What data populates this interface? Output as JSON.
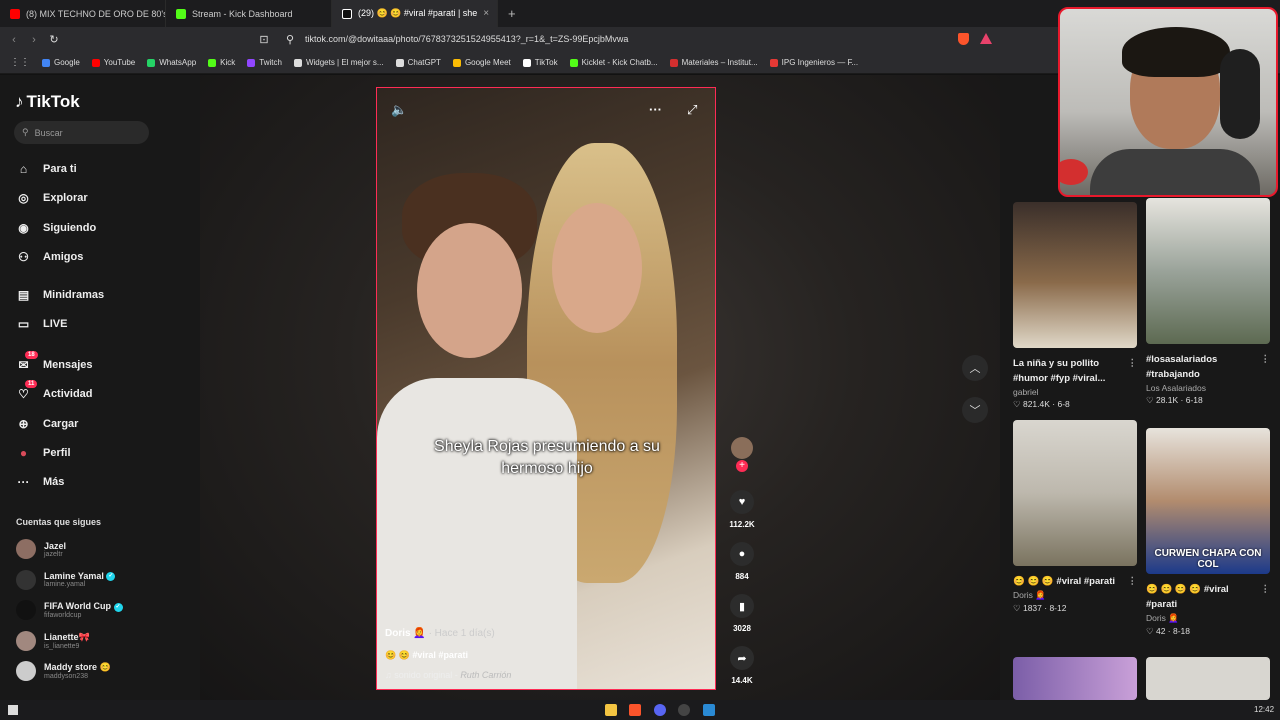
{
  "browser": {
    "tabs": [
      {
        "title": "(8) MIX TECHNO DE ORO DE 80's &",
        "color": "#ff0000"
      },
      {
        "title": "Stream - Kick Dashboard",
        "color": "#53fc18"
      },
      {
        "title": "(29) 😊 😊 #viral #parati | she",
        "color": "#ffffff",
        "close": "×"
      }
    ],
    "new_tab": "+",
    "url": "tiktok.com/@dowitaaa/photo/7678373251524955413?_r=1&_t=ZS-99EpcjbMvwa",
    "bookmarks": [
      {
        "label": "Google",
        "color": "#4285f4"
      },
      {
        "label": "YouTube",
        "color": "#ff0000"
      },
      {
        "label": "WhatsApp",
        "color": "#25d366"
      },
      {
        "label": "Kick",
        "color": "#53fc18"
      },
      {
        "label": "Twitch",
        "color": "#9146ff"
      },
      {
        "label": "Widgets | El mejor s...",
        "color": "#dddddd"
      },
      {
        "label": "ChatGPT",
        "color": "#dddddd"
      },
      {
        "label": "Google Meet",
        "color": "#fbbc04"
      },
      {
        "label": "TikTok",
        "color": "#ffffff"
      },
      {
        "label": "Kicklet - Kick Chatb...",
        "color": "#53fc18"
      },
      {
        "label": "Materiales – Institut...",
        "color": "#d32f2f"
      },
      {
        "label": "IPG Ingenieros — F...",
        "color": "#e53935"
      }
    ]
  },
  "sidebar": {
    "logo": "TikTok",
    "search_placeholder": "Buscar",
    "nav": [
      {
        "label": "Para ti",
        "icon": "home-icon"
      },
      {
        "label": "Explorar",
        "icon": "compass-icon"
      },
      {
        "label": "Siguiendo",
        "icon": "following-icon"
      },
      {
        "label": "Amigos",
        "icon": "friends-icon"
      },
      {
        "label": "Minidramas",
        "icon": "film-icon"
      },
      {
        "label": "LIVE",
        "icon": "live-icon"
      },
      {
        "label": "Mensajes",
        "icon": "message-icon",
        "badge": "18"
      },
      {
        "label": "Actividad",
        "icon": "activity-icon",
        "badge": "11"
      },
      {
        "label": "Cargar",
        "icon": "upload-icon"
      },
      {
        "label": "Perfil",
        "icon": "profile-icon"
      },
      {
        "label": "Más",
        "icon": "more-icon"
      }
    ],
    "following_title": "Cuentas que sigues",
    "following": [
      {
        "name": "Jazel",
        "handle": "jazeltr",
        "color": "#8d6e63"
      },
      {
        "name": "Lamine Yamal",
        "handle": "lamine.yamal",
        "verified": true,
        "color": "#333333"
      },
      {
        "name": "FIFA World Cup",
        "handle": "fifaworldcup",
        "verified": true,
        "color": "#111111"
      },
      {
        "name": "Lianette🎀",
        "handle": "is_lianette9",
        "color": "#a1887f"
      },
      {
        "name": "Maddy store 😊",
        "handle": "maddyson238",
        "color": "#cccccc"
      }
    ]
  },
  "video": {
    "caption": "Sheyla Rojas presumiendo a su hermoso hijo",
    "author": "Doris 👩‍🦰",
    "time_ago": "· Hace 1 día(s)",
    "hashtags": "😊 😊 #viral #parati",
    "sound_label": "sonido original - ",
    "sound_artist": "Ruth Carrión",
    "mute_icon": "🔈",
    "more_icon": "···",
    "fullscreen_icon": "⤢",
    "counts": {
      "likes": "112.2K",
      "comments": "884",
      "saves": "3028",
      "shares": "14.4K"
    }
  },
  "recommendations": [
    {
      "title": "La niña y su pollito #humor #fyp #viral...",
      "author": "gabriel",
      "stats": "♡ 821.4K · 6-8",
      "overlay": ""
    },
    {
      "title": "#losasalariados #trabajando",
      "author": "Los Asalariados",
      "stats": "♡ 28.1K · 6-18",
      "overlay": ""
    },
    {
      "title": "😊 😊 😊 #viral #parati",
      "author": "Doris 👩‍🦰",
      "stats": "♡ 1837 · 8-12",
      "overlay": ""
    },
    {
      "title": "😊 😊 😊 😊 #viral #parati",
      "author": "Doris 👩‍🦰",
      "stats": "♡ 42 · 8-18",
      "overlay": "CURWEN CHAPA CON COL"
    }
  ],
  "taskbar": {
    "time": "12:42"
  }
}
